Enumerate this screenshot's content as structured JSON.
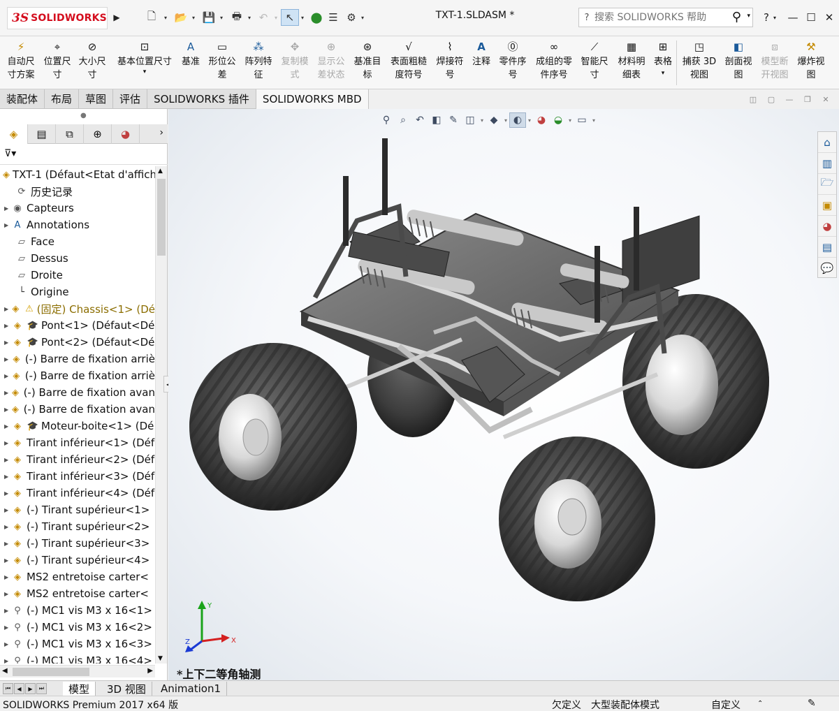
{
  "app": {
    "logo_prefix": "3S",
    "logo_text": "SOLIDWORKS",
    "doc_title": "TXT-1.SLDASM *",
    "search_placeholder": "搜索 SOLIDWORKS 帮助",
    "help_label": "?",
    "win_min": "—",
    "win_max": "☐",
    "win_close": "✕"
  },
  "ribbon": [
    {
      "label": "自动尺\n寸方案",
      "icon": "auto-dimension-icon",
      "enabled": true
    },
    {
      "label": "位置尺\n寸",
      "icon": "location-dimension-icon",
      "enabled": true
    },
    {
      "label": "大小尺\n寸",
      "icon": "size-dimension-icon",
      "enabled": true
    },
    {
      "label": "基本位置尺寸",
      "icon": "basic-location-dimension-icon",
      "enabled": true
    },
    {
      "label": "基准",
      "icon": "datum-icon",
      "enabled": true
    },
    {
      "label": "形位公\n差",
      "icon": "geometric-tolerance-icon",
      "enabled": true
    },
    {
      "label": "阵列特\n征",
      "icon": "pattern-feature-icon",
      "enabled": true
    },
    {
      "label": "复制模\n式",
      "icon": "copy-scheme-icon",
      "enabled": false
    },
    {
      "label": "显示公\n差状态",
      "icon": "tolerance-status-icon",
      "enabled": false
    },
    {
      "label": "基准目\n标",
      "icon": "datum-target-icon",
      "enabled": true
    },
    {
      "label": "表面粗糙\n度符号",
      "icon": "surface-finish-icon",
      "enabled": true
    },
    {
      "label": "焊接符\n号",
      "icon": "weld-symbol-icon",
      "enabled": true
    },
    {
      "label": "注释",
      "icon": "note-icon",
      "enabled": true
    },
    {
      "label": "零件序\n号",
      "icon": "balloon-icon",
      "enabled": true
    },
    {
      "label": "成组的零\n件序号",
      "icon": "stacked-balloon-icon",
      "enabled": true
    },
    {
      "label": "智能尺\n寸",
      "icon": "smart-dimension-icon",
      "enabled": true
    },
    {
      "label": "材料明\n细表",
      "icon": "bom-icon",
      "enabled": true
    },
    {
      "label": "表格",
      "icon": "table-icon",
      "enabled": true
    },
    {
      "label": "捕获 3D\n视图",
      "icon": "capture-3d-view-icon",
      "enabled": true
    },
    {
      "label": "剖面视\n图",
      "icon": "section-view-icon",
      "enabled": true
    },
    {
      "label": "模型断\n开视图",
      "icon": "model-break-view-icon",
      "enabled": false
    },
    {
      "label": "爆炸视\n图",
      "icon": "exploded-view-icon",
      "enabled": true
    }
  ],
  "tabs": [
    "装配体",
    "布局",
    "草图",
    "评估",
    "SOLIDWORKS 插件",
    "SOLIDWORKS MBD"
  ],
  "active_tab": 5,
  "tree": [
    {
      "label": "TXT-1  (Défaut<Etat d'affich",
      "kind": "root"
    },
    {
      "label": "历史记录",
      "kind": "history"
    },
    {
      "label": "Capteurs",
      "kind": "sensors"
    },
    {
      "label": "Annotations",
      "kind": "annotations"
    },
    {
      "label": "Face",
      "kind": "plane"
    },
    {
      "label": "Dessus",
      "kind": "plane"
    },
    {
      "label": "Droite",
      "kind": "plane"
    },
    {
      "label": "Origine",
      "kind": "origin"
    },
    {
      "label": "(固定) Chassis<1> (Dé",
      "kind": "warn"
    },
    {
      "label": "Pont<1> (Défaut<Dé",
      "kind": "sub"
    },
    {
      "label": "Pont<2> (Défaut<Dé",
      "kind": "sub"
    },
    {
      "label": "(-) Barre de fixation arriè",
      "kind": "part"
    },
    {
      "label": "(-) Barre de fixation arriè",
      "kind": "part"
    },
    {
      "label": "(-) Barre de fixation avan",
      "kind": "part"
    },
    {
      "label": "(-) Barre de fixation avan",
      "kind": "part"
    },
    {
      "label": "Moteur-boite<1> (Dé",
      "kind": "sub"
    },
    {
      "label": "Tirant inférieur<1> (Déf",
      "kind": "part"
    },
    {
      "label": "Tirant inférieur<2> (Déf",
      "kind": "part"
    },
    {
      "label": "Tirant inférieur<3> (Déf",
      "kind": "part"
    },
    {
      "label": "Tirant inférieur<4> (Déf",
      "kind": "part"
    },
    {
      "label": "(-) Tirant supérieur<1>",
      "kind": "part"
    },
    {
      "label": "(-) Tirant supérieur<2>",
      "kind": "part"
    },
    {
      "label": "(-) Tirant supérieur<3>",
      "kind": "part"
    },
    {
      "label": "(-) Tirant supérieur<4>",
      "kind": "part"
    },
    {
      "label": "MS2 entretoise carter<",
      "kind": "part"
    },
    {
      "label": "MS2 entretoise carter<",
      "kind": "part"
    },
    {
      "label": "(-) MC1 vis M3 x 16<1>",
      "kind": "screw"
    },
    {
      "label": "(-) MC1 vis M3 x 16<2>",
      "kind": "screw"
    },
    {
      "label": "(-) MC1 vis M3 x 16<3>",
      "kind": "screw"
    },
    {
      "label": "(-) MC1 vis M3 x 16<4>",
      "kind": "screw"
    }
  ],
  "view_orientation": "*上下二等角轴测",
  "triad": {
    "x": "X",
    "y": "Y",
    "z": "Z"
  },
  "bottom_tabs": [
    "模型",
    "3D 视图",
    "Animation1"
  ],
  "active_bottom_tab": 0,
  "status": {
    "product": "SOLIDWORKS Premium 2017 x64 版",
    "defined": "欠定义",
    "mode": "大型装配体模式",
    "custom": "自定义",
    "custom_arrow": "⌃"
  }
}
